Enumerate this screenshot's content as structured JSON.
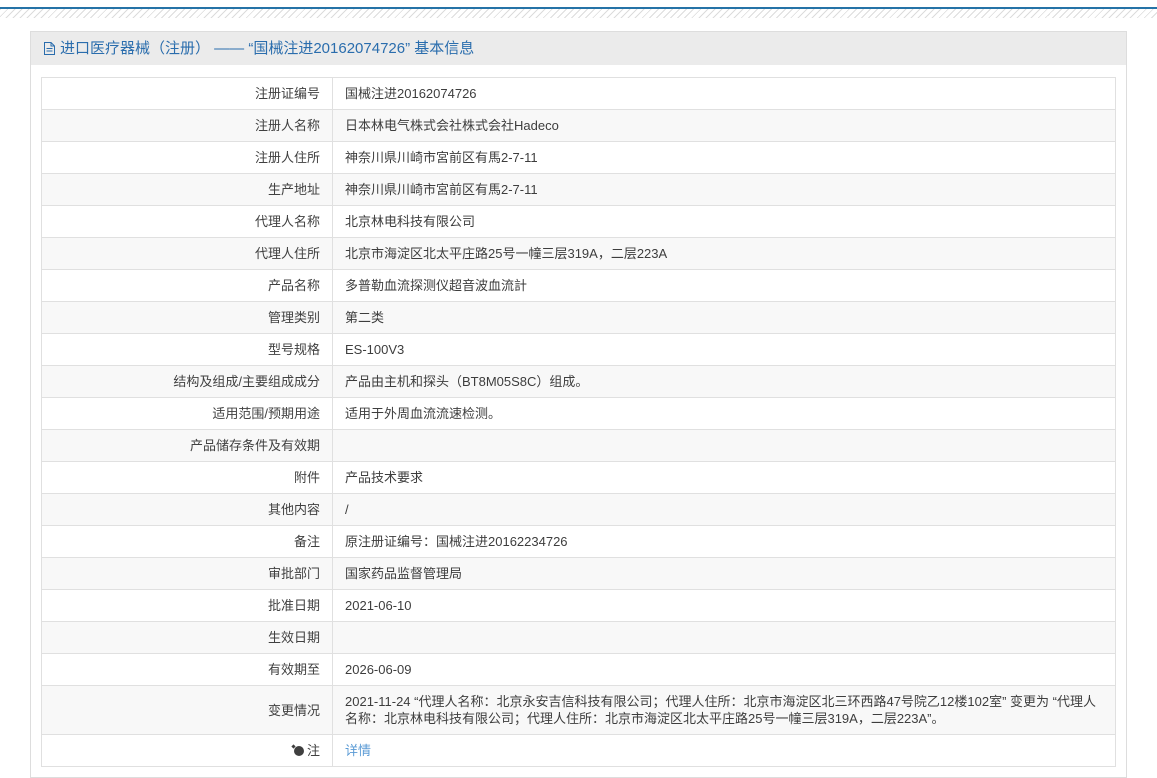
{
  "page": {
    "top_accent_color": "#2573a7",
    "link_color": "#5b9bd5",
    "title_color": "#2a6dad"
  },
  "header": {
    "icon": "document-icon",
    "title": "进口医疗器械（注册） —— “国械注进20162074726” 基本信息"
  },
  "table": {
    "rows": [
      {
        "label": "注册证编号",
        "value": "国械注进20162074726"
      },
      {
        "label": "注册人名称",
        "value": "日本林电气株式会社株式会社Hadeco"
      },
      {
        "label": "注册人住所",
        "value": "神奈川県川崎市宮前区有馬2-7-11"
      },
      {
        "label": "生产地址",
        "value": "神奈川県川崎市宮前区有馬2-7-11"
      },
      {
        "label": "代理人名称",
        "value": "北京林电科技有限公司"
      },
      {
        "label": "代理人住所",
        "value": "北京市海淀区北太平庄路25号一幢三层319A，二层223A"
      },
      {
        "label": "产品名称",
        "value": "多普勒血流探测仪超音波血流計"
      },
      {
        "label": "管理类别",
        "value": "第二类"
      },
      {
        "label": "型号规格",
        "value": "ES-100V3"
      },
      {
        "label": "结构及组成/主要组成成分",
        "value": "产品由主机和探头（BT8M05S8C）组成。"
      },
      {
        "label": "适用范围/预期用途",
        "value": "适用于外周血流流速检测。"
      },
      {
        "label": "产品储存条件及有效期",
        "value": ""
      },
      {
        "label": "附件",
        "value": "产品技术要求"
      },
      {
        "label": "其他内容",
        "value": "/"
      },
      {
        "label": "备注",
        "value": "原注册证编号：国械注进20162234726"
      },
      {
        "label": "审批部门",
        "value": "国家药品监督管理局"
      },
      {
        "label": "批准日期",
        "value": "2021-06-10"
      },
      {
        "label": "生效日期",
        "value": ""
      },
      {
        "label": "有效期至",
        "value": "2026-06-09"
      },
      {
        "label": "变更情况",
        "value": "2021-11-24 “代理人名称：北京永安吉信科技有限公司；代理人住所：北京市海淀区北三环西路47号院乙12楼102室” 变更为 “代理人名称：北京林电科技有限公司；代理人住所：北京市海淀区北太平庄路25号一幢三层319A，二层223A”。"
      },
      {
        "label": "注",
        "value": "详情",
        "link": true,
        "icon": "note-icon"
      }
    ]
  }
}
